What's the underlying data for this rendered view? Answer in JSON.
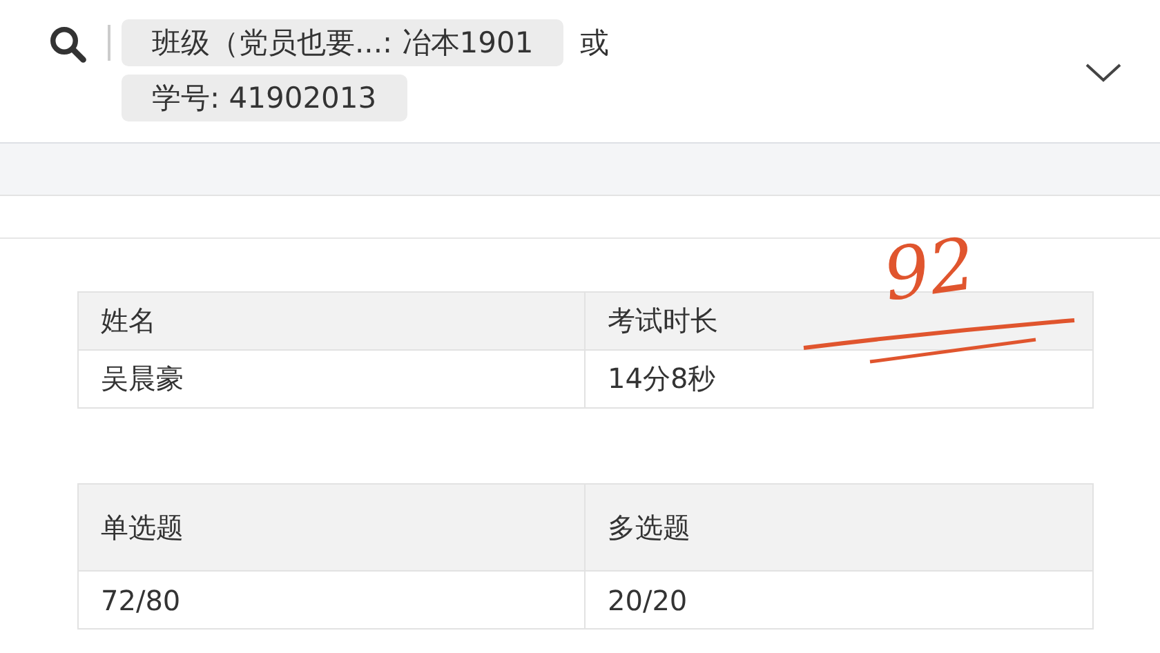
{
  "filter": {
    "chips": [
      {
        "label": "班级（党员也要...: 冶本1901"
      },
      {
        "label": "学号: 41902013"
      }
    ],
    "joiner": "或"
  },
  "score_mark": "92",
  "tables": [
    {
      "columns": [
        "姓名",
        "考试时长"
      ],
      "rows": [
        [
          "吴晨豪",
          "14分8秒"
        ]
      ]
    },
    {
      "columns": [
        "单选题",
        "多选题"
      ],
      "rows": [
        [
          "72/80",
          "20/20"
        ]
      ]
    }
  ]
}
